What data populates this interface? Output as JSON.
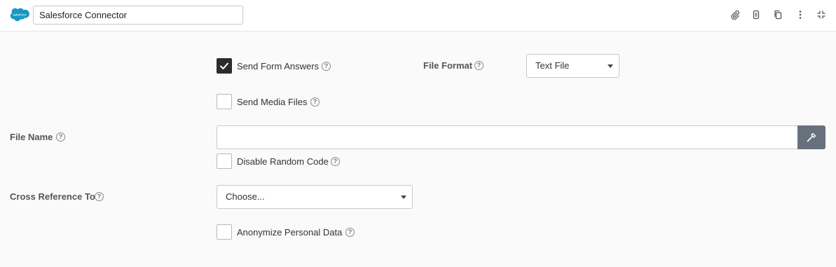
{
  "header": {
    "logo_text": "salesforce",
    "title_value": "Salesforce Connector",
    "icons": [
      "paperclip-icon",
      "document-settings-icon",
      "copy-icon",
      "more-vertical-icon",
      "collapse-icon"
    ]
  },
  "form": {
    "send_form_answers": {
      "label": "Send Form Answers",
      "checked": true
    },
    "file_format": {
      "label": "File Format",
      "selected": "Text File"
    },
    "send_media_files": {
      "label": "Send Media Files",
      "checked": false
    },
    "file_name": {
      "label": "File Name",
      "value": "",
      "button_icon": "magic-wand-icon"
    },
    "disable_random_code": {
      "label": "Disable Random Code",
      "checked": false
    },
    "cross_reference": {
      "label": "Cross Reference To",
      "selected": "Choose..."
    },
    "anonymize": {
      "label": "Anonymize Personal Data",
      "checked": false
    },
    "help_glyph": "?"
  },
  "colors": {
    "salesforce_blue": "#1798c1",
    "checked_fill": "#2b2b2b",
    "wand_button": "#66717c"
  }
}
